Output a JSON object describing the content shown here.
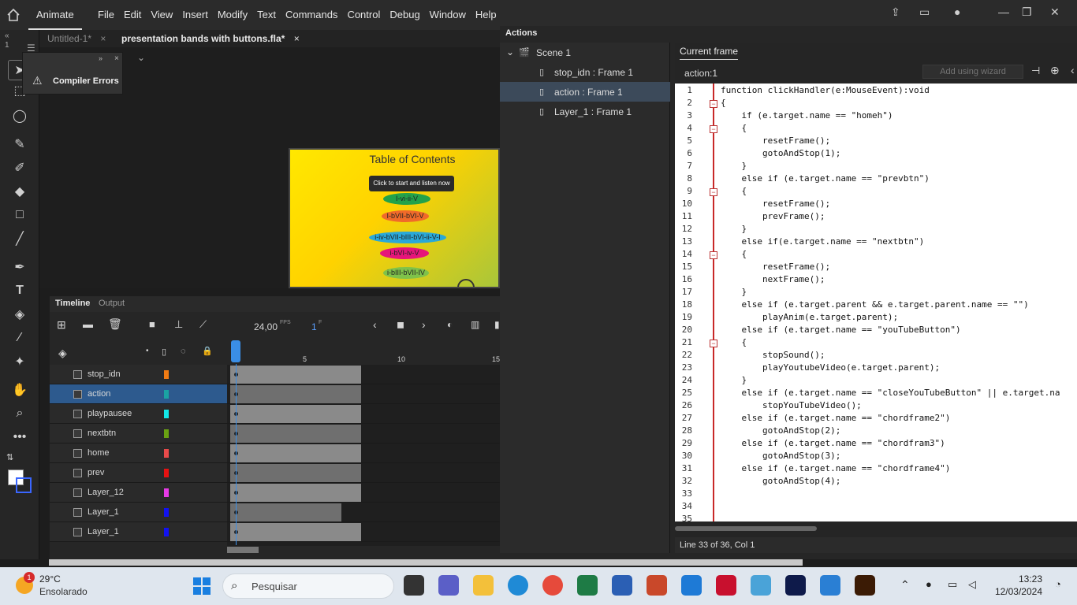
{
  "app": {
    "brand": "Animate",
    "menus": [
      "File",
      "Edit",
      "View",
      "Insert",
      "Modify",
      "Text",
      "Commands",
      "Control",
      "Debug",
      "Window",
      "Help"
    ]
  },
  "doc_tabs": [
    {
      "label": "Untitled-1*",
      "active": false
    },
    {
      "label": "presentation bands with buttons.fla*",
      "active": true
    }
  ],
  "compiler": {
    "label": "Compiler Errors"
  },
  "stage": {
    "title": "Table of Contents",
    "button": "Click to start and listen now",
    "pills": [
      {
        "label": "I-vi-ii-V",
        "color": "#23a24a"
      },
      {
        "label": "I-bVII-bVI-V",
        "color": "#f06a2a"
      },
      {
        "label": "i-iv-bVII-bIII-bVI-ii-V-I",
        "color": "#2aa8d8"
      },
      {
        "label": "i-bVI-iv-V",
        "color": "#e6157a"
      },
      {
        "label": "i-bIII-bVII-IV",
        "color": "#7fc24a"
      }
    ]
  },
  "timeline": {
    "tabs": [
      "Timeline",
      "Output"
    ],
    "fps": "24,00",
    "fps_unit": "FPS",
    "frame": "1",
    "frame_unit": "F",
    "ruler": [
      "5",
      "10",
      "15"
    ],
    "layers": [
      {
        "name": "stop_idn",
        "color": "#f07b13",
        "selected": false,
        "span": 13
      },
      {
        "name": "action",
        "color": "#1aa3a3",
        "selected": true,
        "span": 13
      },
      {
        "name": "playpausee",
        "color": "#12e8e8",
        "selected": false,
        "span": 13
      },
      {
        "name": "nextbtn",
        "color": "#6aa212",
        "selected": false,
        "span": 13
      },
      {
        "name": "home",
        "color": "#e84a4a",
        "selected": false,
        "span": 13
      },
      {
        "name": "prev",
        "color": "#e61212",
        "selected": false,
        "span": 13
      },
      {
        "name": "Layer_12",
        "color": "#e63ae6",
        "selected": false,
        "span": 13
      },
      {
        "name": "Layer_1",
        "color": "#1212f0",
        "selected": false,
        "span": 11
      },
      {
        "name": "Layer_1",
        "color": "#1212f0",
        "selected": false,
        "span": 13
      }
    ]
  },
  "actions": {
    "panel_title": "Actions",
    "tree": [
      {
        "label": "Scene 1",
        "type": "scene"
      },
      {
        "label": "stop_idn : Frame 1",
        "type": "frame",
        "selected": false
      },
      {
        "label": "action : Frame 1",
        "type": "frame",
        "selected": true
      },
      {
        "label": "Layer_1 : Frame 1",
        "type": "frame",
        "selected": false
      }
    ],
    "editor_tab": "Current frame",
    "frame_label": "action:1",
    "wizard_placeholder": "Add using wizard",
    "status": "Line 33 of 36, Col 1",
    "code": [
      "function clickHandler(e:MouseEvent):void",
      "{",
      "    if (e.target.name == \"homeh\")",
      "    {",
      "        resetFrame();",
      "        gotoAndStop(1);",
      "    }",
      "    else if (e.target.name == \"prevbtn\")",
      "    {",
      "        resetFrame();",
      "        prevFrame();",
      "    }",
      "    else if(e.target.name == \"nextbtn\")",
      "    {",
      "        resetFrame();",
      "        nextFrame();",
      "    }",
      "    else if (e.target.parent && e.target.parent.name == \"\")",
      "        playAnim(e.target.parent);",
      "    else if (e.target.name == \"youTubeButton\")",
      "    {",
      "        stopSound();",
      "        playYoutubeVideo(e.target.parent);",
      "    }",
      "    else if (e.target.name == \"closeYouTubeButton\" || e.target.na",
      "        stopYouTubeVideo();",
      "    else if (e.target.name == \"chordframe2\")",
      "        gotoAndStop(2);",
      "    else if (e.target.name == \"chordfram3\")",
      "        gotoAndStop(3);",
      "    else if (e.target.name == \"chordframe4\")",
      "        gotoAndStop(4);",
      "",
      "",
      ""
    ],
    "fold_lines": [
      2,
      4,
      9,
      14,
      21
    ]
  },
  "taskbar": {
    "weather_temp": "29°C",
    "weather_desc": "Ensolarado",
    "weather_badge": "1",
    "search_placeholder": "Pesquisar",
    "time": "13:23",
    "date": "12/03/2024"
  }
}
